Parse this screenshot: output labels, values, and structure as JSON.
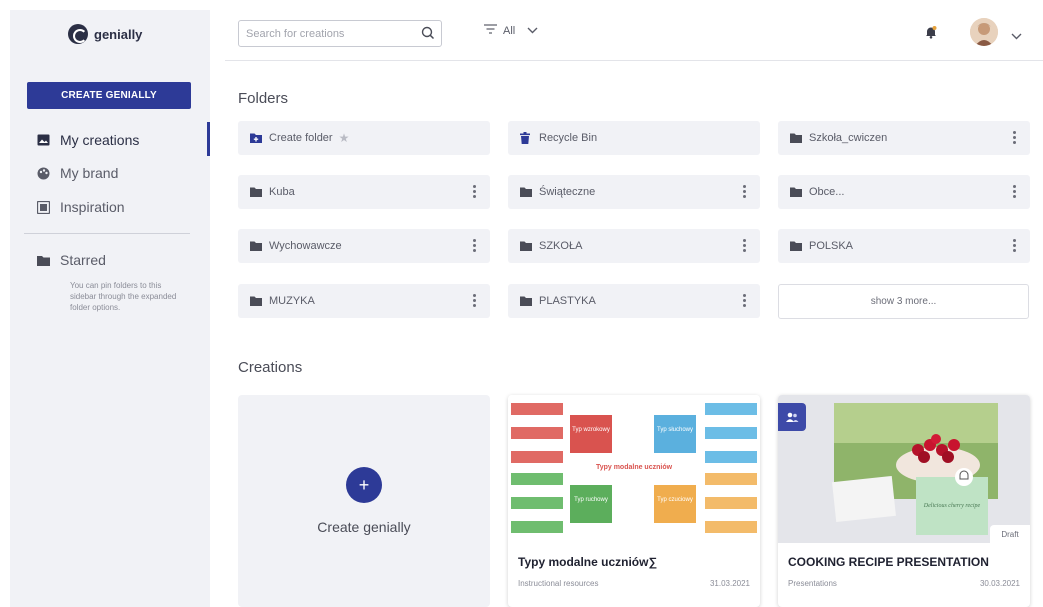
{
  "app": {
    "name": "genially"
  },
  "sidebar": {
    "create_button": "CREATE GENIALLY",
    "items": [
      {
        "label": "My creations",
        "icon": "image-icon",
        "active": true
      },
      {
        "label": "My brand",
        "icon": "palette-icon",
        "active": false
      },
      {
        "label": "Inspiration",
        "icon": "gallery-icon",
        "active": false
      }
    ],
    "starred": {
      "label": "Starred",
      "hint": "You can pin folders to this sidebar through the expanded folder options."
    }
  },
  "header": {
    "search": {
      "placeholder": "Search for creations",
      "value": ""
    },
    "filter": {
      "label": "All"
    }
  },
  "folders": {
    "title": "Folders",
    "items": [
      {
        "label": "Create folder",
        "icon": "folder-plus-icon",
        "type": "action"
      },
      {
        "label": "Recycle Bin",
        "icon": "trash-icon",
        "type": "bin"
      },
      {
        "label": "Szkoła_cwiczen",
        "icon": "folder-icon",
        "type": "folder"
      },
      {
        "label": "Kuba",
        "icon": "folder-icon",
        "type": "folder"
      },
      {
        "label": "Świąteczne",
        "icon": "folder-icon",
        "type": "folder"
      },
      {
        "label": "Obce...",
        "icon": "folder-icon",
        "type": "folder"
      },
      {
        "label": "Wychowawcze",
        "icon": "folder-icon",
        "type": "folder"
      },
      {
        "label": "SZKOŁA",
        "icon": "folder-icon",
        "type": "folder"
      },
      {
        "label": "POLSKA",
        "icon": "folder-icon",
        "type": "folder"
      },
      {
        "label": "MUZYKA",
        "icon": "folder-icon",
        "type": "folder"
      },
      {
        "label": "PLASTYKA",
        "icon": "folder-icon",
        "type": "folder"
      }
    ],
    "show_more": "show 3 more..."
  },
  "creations": {
    "title": "Creations",
    "create_label": "Create genially",
    "cards": [
      {
        "title": "Typy modalne uczniów∑",
        "category": "Instructional resources",
        "date": "31.03.2021",
        "thumb_center_text": "Typy modalne uczniów",
        "thumb_boxes": [
          "Typ wzrokowy",
          "Typ słuchowy",
          "Typ ruchowy",
          "Typ czuciowy"
        ],
        "colors": {
          "red": "#d9534f",
          "blue": "#5bb0de",
          "green": "#5cae5c",
          "orange": "#f0ad4e"
        }
      },
      {
        "title": "COOKING RECIPE PRESENTATION",
        "category": "Presentations",
        "date": "30.03.2021",
        "badge": "Draft",
        "note_text": "Delicious cherry recipe"
      }
    ]
  },
  "colors": {
    "accent": "#2d3a97",
    "sidebar_bg": "#f1f2f6"
  }
}
